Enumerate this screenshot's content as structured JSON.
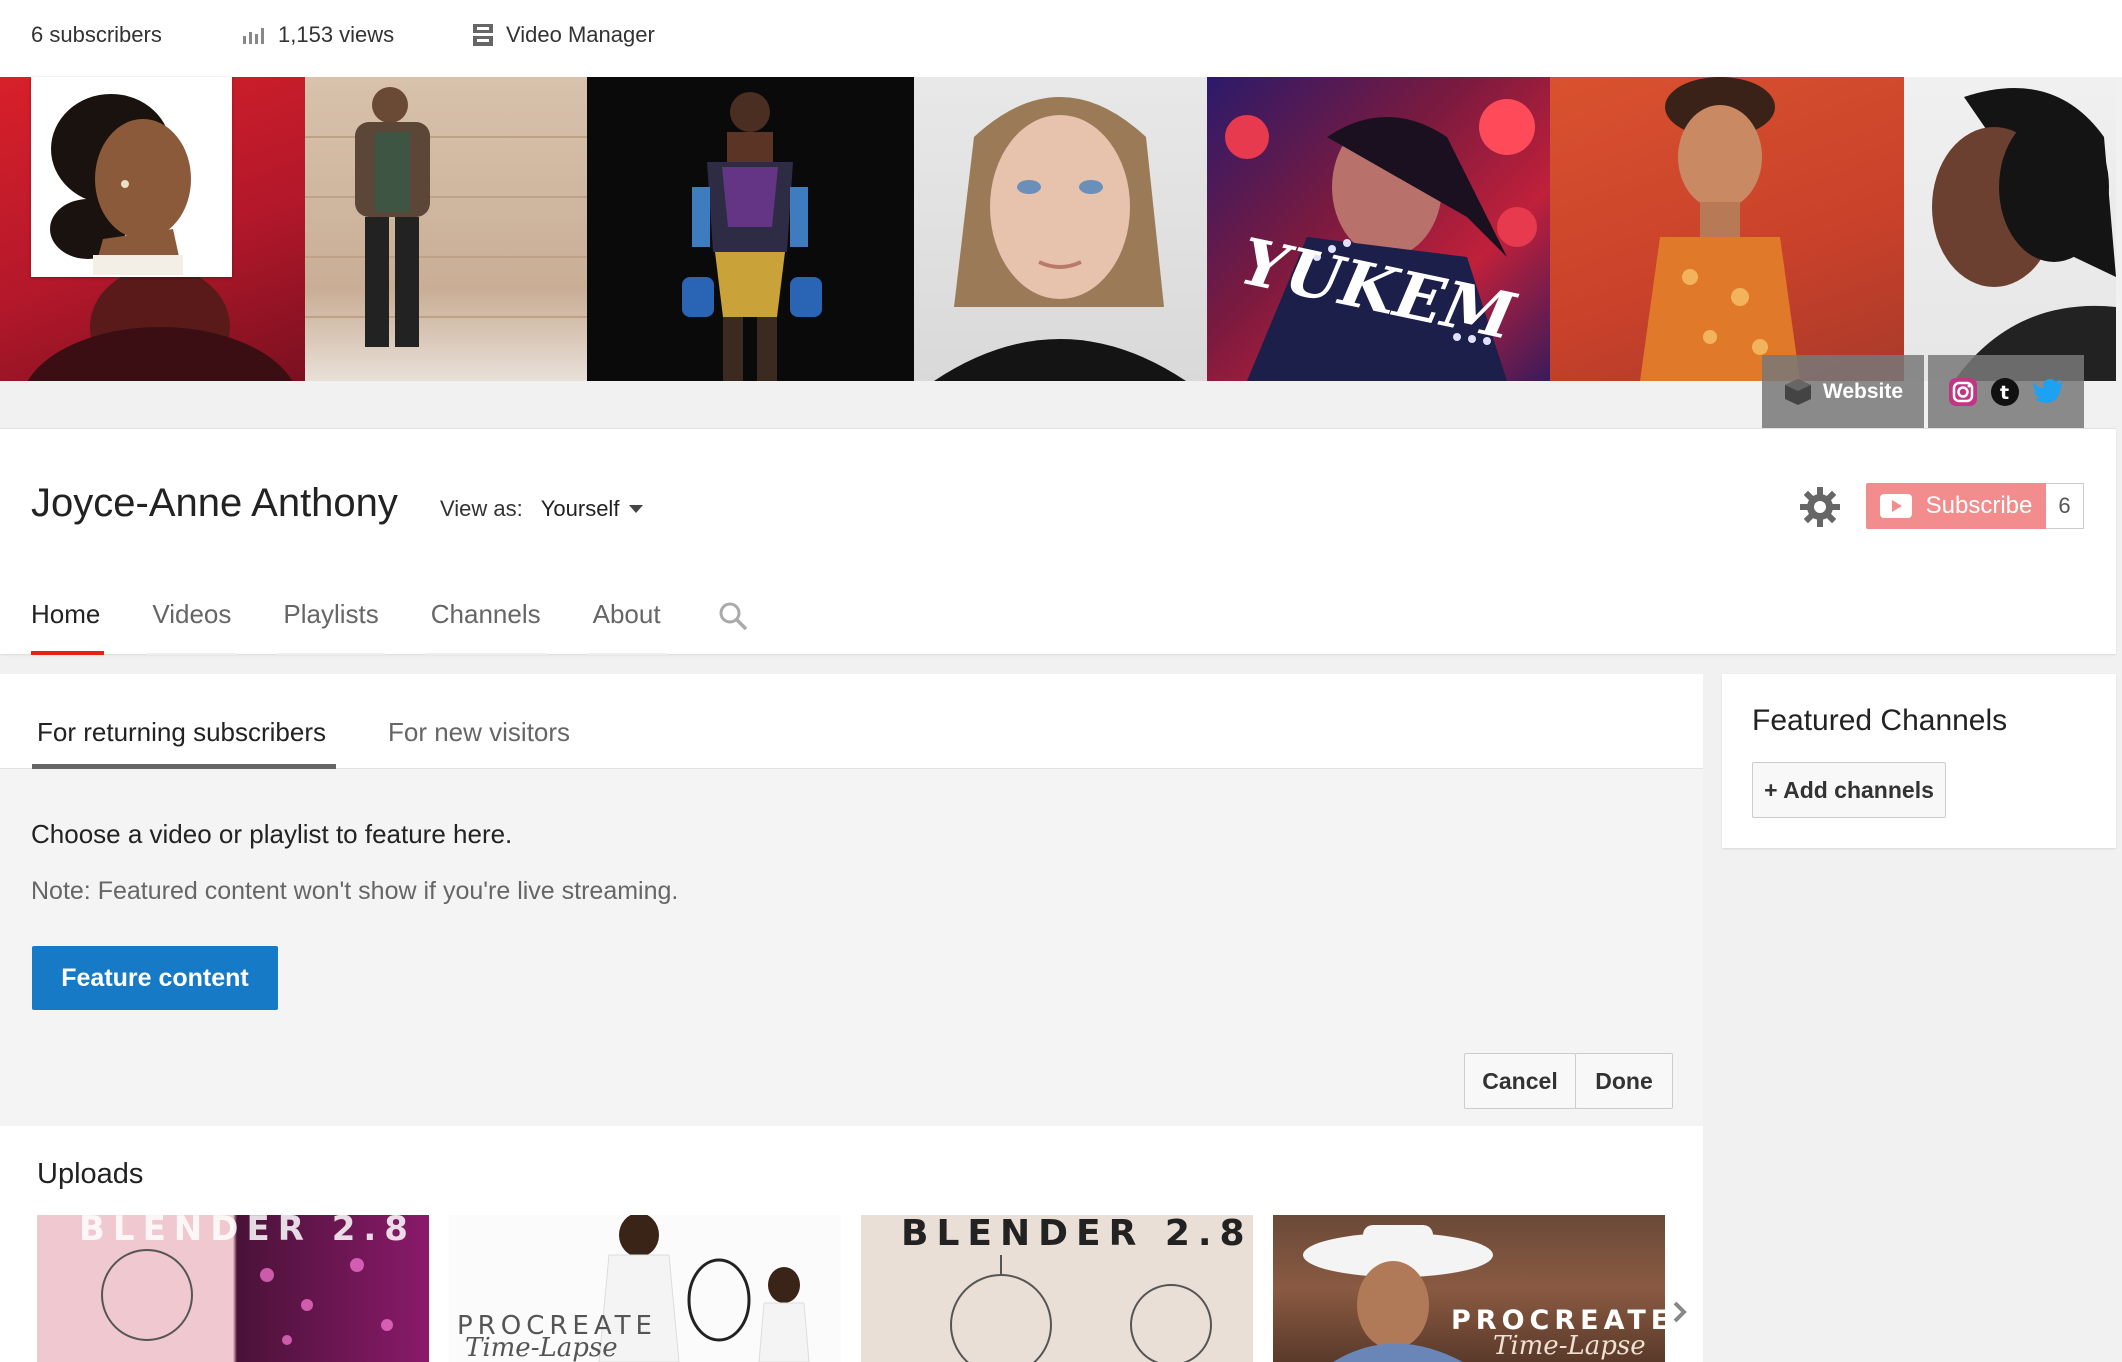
{
  "topbar": {
    "subscribers": "6 subscribers",
    "views": "1,153 views",
    "video_manager": "Video Manager"
  },
  "banner": {
    "website_label": "Website",
    "social": [
      "instagram-icon",
      "tumblr-icon",
      "twitter-icon"
    ],
    "social_colors": {
      "instagram": "#c13584",
      "tumblr": "#35465c",
      "twitter": "#1da1f2"
    }
  },
  "channel": {
    "name": "Joyce-Anne Anthony",
    "view_as_label": "View as:",
    "view_as_value": "Yourself",
    "subscribe_label": "Subscribe",
    "subscribe_count": "6"
  },
  "tabs": [
    "Home",
    "Videos",
    "Playlists",
    "Channels",
    "About"
  ],
  "active_tab": "Home",
  "feature": {
    "subtabs": [
      "For returning subscribers",
      "For new visitors"
    ],
    "choose_text": "Choose a video or playlist to feature here.",
    "note_text": "Note: Featured content won't show if you're live streaming.",
    "feature_button": "Feature content",
    "cancel_button": "Cancel",
    "done_button": "Done"
  },
  "uploads": {
    "title": "Uploads",
    "thumbs": [
      {
        "top_text": "BLENDER 2.8"
      },
      {
        "bottom_text": "PROCREATE",
        "sub_text": "Time-Lapse"
      },
      {
        "top_text": "BLENDER 2.8"
      },
      {
        "bottom_text": "PROCREATE",
        "sub_text": "Time-Lapse"
      }
    ]
  },
  "sidebar": {
    "title": "Featured Channels",
    "add_button": "+ Add channels"
  },
  "colors": {
    "accent_red": "#e62117",
    "subscribe_bg": "#f38d8d",
    "feature_blue": "#167ac6"
  }
}
